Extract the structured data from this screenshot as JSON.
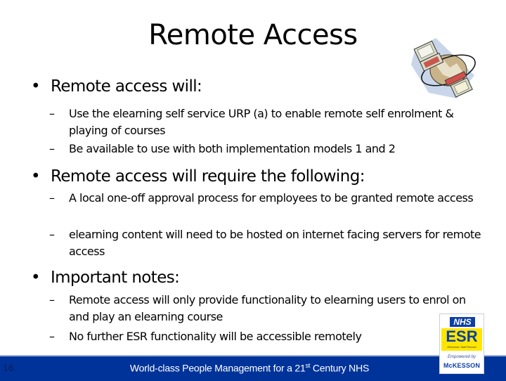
{
  "slide": {
    "title": "Remote Access",
    "sections": [
      {
        "heading": "Remote access will:",
        "items": [
          "Use the elearning self service URP (a) to enable remote self enrolment & playing of courses",
          "Be available to use with both implementation models 1 and 2"
        ]
      },
      {
        "heading": "Remote access will require the following:",
        "items": [
          "A local one-off approval process for employees to be granted remote access",
          "elearning content will need to be hosted on internet facing servers for remote access"
        ]
      },
      {
        "heading": "Important notes:",
        "items": [
          "Remote access will only provide functionality to elearning users to enrol on and play an elearning course",
          "No further ESR functionality will be accessible remotely"
        ]
      }
    ],
    "bullet_symbol": "•",
    "dash_symbol": "–"
  },
  "footer": {
    "page_number": "16",
    "tagline_before": "World-class People Management for a 21",
    "tagline_sup": "st",
    "tagline_after": " Century NHS",
    "background_color": "#003399"
  },
  "clipart": {
    "icon": "networked-computers-globe-icon"
  },
  "logo": {
    "nhs": "NHS",
    "esr": "ESR",
    "esr_subtitle": "Electronic Staff Record",
    "empowered_by": "Empowered by",
    "company": "McKESSON"
  }
}
